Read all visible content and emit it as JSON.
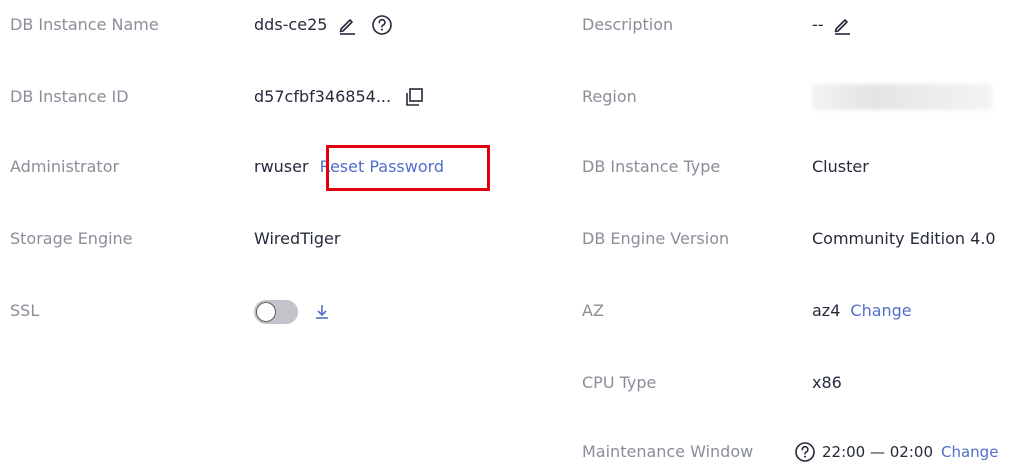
{
  "left": {
    "instance_name": {
      "label": "DB Instance Name",
      "value": "dds-ce25"
    },
    "instance_id": {
      "label": "DB Instance ID",
      "value": "d57cfbf346854..."
    },
    "administrator": {
      "label": "Administrator",
      "value": "rwuser",
      "action": "Reset Password"
    },
    "storage_engine": {
      "label": "Storage Engine",
      "value": "WiredTiger"
    },
    "ssl": {
      "label": "SSL",
      "enabled": false
    }
  },
  "right": {
    "description": {
      "label": "Description",
      "value": "--"
    },
    "region": {
      "label": "Region",
      "value": ""
    },
    "instance_type": {
      "label": "DB Instance Type",
      "value": "Cluster"
    },
    "engine_version": {
      "label": "DB Engine Version",
      "value": "Community Edition 4.0"
    },
    "az": {
      "label": "AZ",
      "value": "az4",
      "action": "Change"
    },
    "cpu_type": {
      "label": "CPU Type",
      "value": "x86"
    },
    "maintenance_window": {
      "label": "Maintenance Window",
      "value": "22:00 — 02:00",
      "action": "Change"
    }
  },
  "icons": {
    "edit": "pencil-icon",
    "help": "question-circle-icon",
    "copy": "copy-icon",
    "download": "download-icon"
  },
  "colors": {
    "label": "#8a8e99",
    "value": "#252b3a",
    "link": "#526ecc",
    "highlight": "#e0000e"
  }
}
